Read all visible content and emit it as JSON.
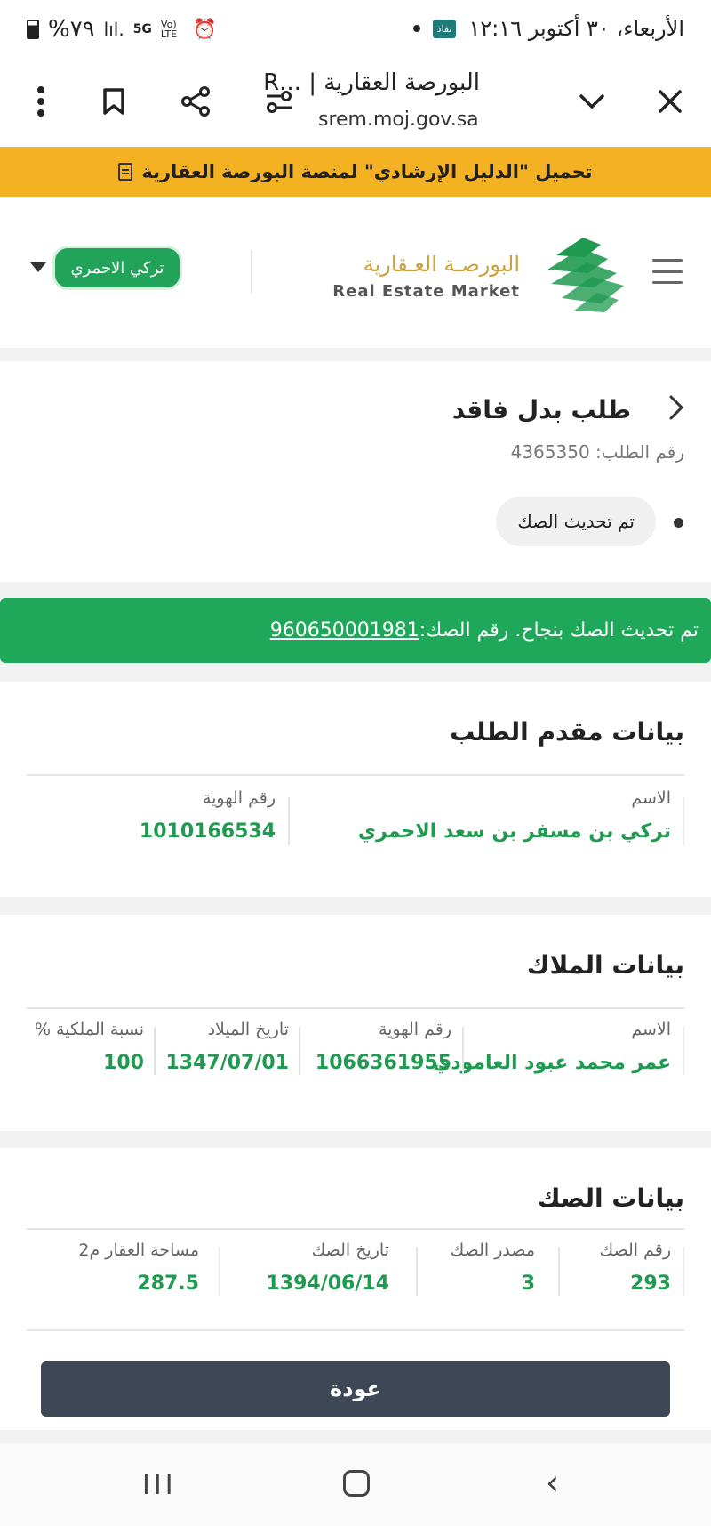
{
  "status_bar": {
    "datetime": "الأربعاء، ٣٠ أكتوبر ١٢:١٦",
    "app_badge": "نفاذ",
    "battery": "%٧٩",
    "signal": "lıl.",
    "network": "5G",
    "volte": "Vo) LTE"
  },
  "browser": {
    "title": "البورصة العقارية | ...R",
    "url": "srem.moj.gov.sa"
  },
  "banner": {
    "text": "تحميل \"الدليل الإرشادي\" لمنصة البورصة العقارية"
  },
  "header": {
    "logo_ar": "البورصـة العـقارية",
    "logo_en": "Real Estate Market",
    "user_name": "تركي الاحمري"
  },
  "request": {
    "title": "طلب بدل فاقد",
    "number_label": "رقم الطلب:",
    "number_value": "4365350",
    "status": "تم تحديث الصك"
  },
  "alert": {
    "text": "تم تحديث الصك بنجاح. رقم الصك:",
    "deed_number": "960650001981"
  },
  "applicant": {
    "title": "بيانات مقدم الطلب",
    "name_label": "الاسم",
    "name_value": "تركي بن مسفر بن سعد الاحمري",
    "id_label": "رقم الهوية",
    "id_value": "1010166534"
  },
  "owners": {
    "title": "بيانات الملاك",
    "name_label": "الاسم",
    "name_value": "عمر محمد عبود العامودي",
    "id_label": "رقم الهوية",
    "id_value": "1066361955",
    "birth_label": "تاريخ الميلاد",
    "birth_value": "1347/07/01",
    "share_label": "نسبة الملكية %",
    "share_value": "100"
  },
  "deed": {
    "title": "بيانات الصك",
    "number_label": "رقم الصك",
    "number_value": "293",
    "source_label": "مصدر الصك",
    "source_value": "3",
    "date_label": "تاريخ الصك",
    "date_value": "1394/06/14",
    "area_label": "مساحة العقار م2",
    "area_value": "287.5"
  },
  "actions": {
    "back_label": "عودة"
  },
  "nav": {
    "recent": "III",
    "back": "‹"
  },
  "colors": {
    "accent_green": "#1fa85a",
    "banner_yellow": "#f4b223",
    "button_dark": "#3d4756"
  }
}
